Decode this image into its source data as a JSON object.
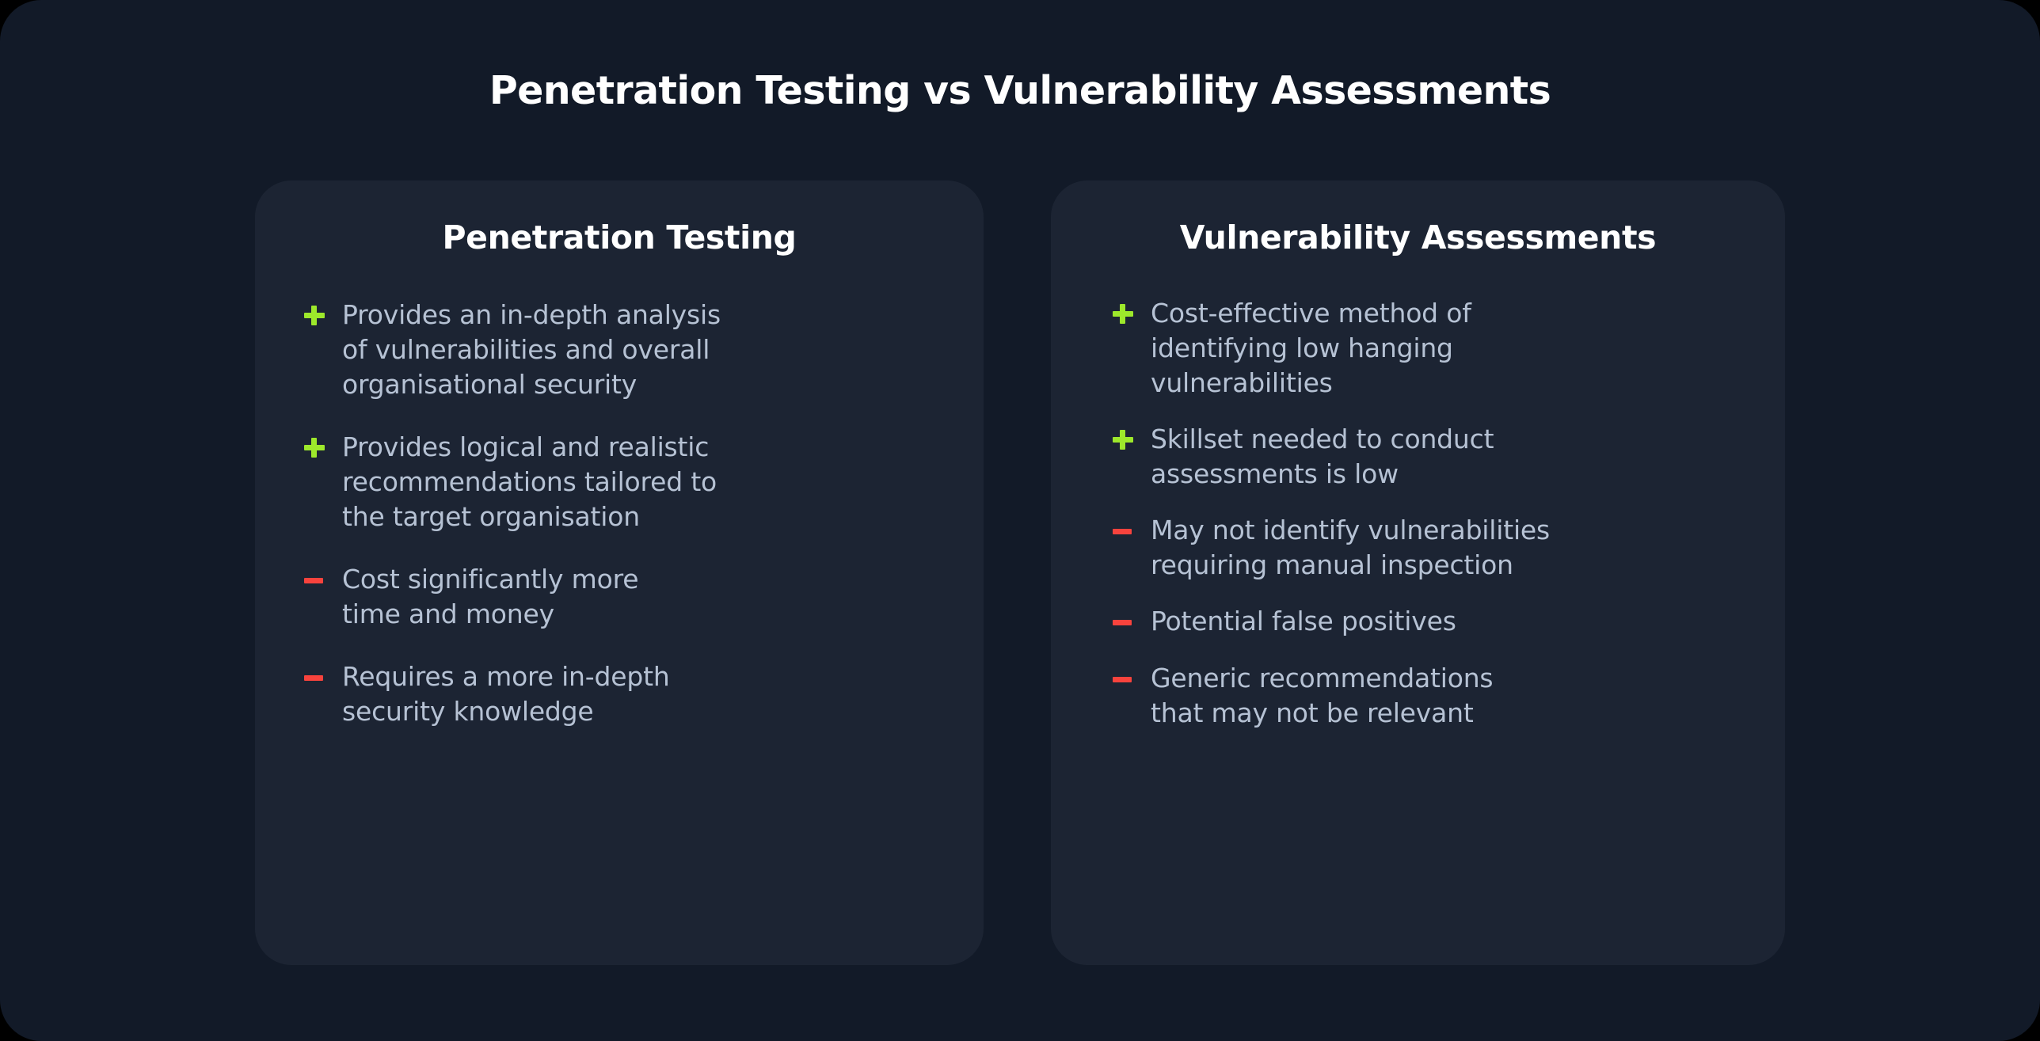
{
  "title": "Penetration Testing vs Vulnerability Assessments",
  "colors": {
    "page_background": "#121A28",
    "card_background": "#1C2433",
    "title_text": "#FFFFFF",
    "body_text": "#B6C2D4",
    "plus_marker": "#9DE82B",
    "minus_marker": "#F8433D"
  },
  "cards": [
    {
      "heading": "Penetration Testing",
      "bullets": [
        {
          "marker": "plus-icon",
          "type": "plus",
          "text": "Provides an in-depth analysis\nof vulnerabilities and overall\norganisational security"
        },
        {
          "marker": "plus-icon",
          "type": "plus",
          "text": "Provides logical and realistic\nrecommendations tailored to\nthe target organisation"
        },
        {
          "marker": "minus-icon",
          "type": "minus",
          "text": "Cost significantly more\ntime and money"
        },
        {
          "marker": "minus-icon",
          "type": "minus",
          "text": "Requires a more in-depth\nsecurity knowledge"
        }
      ]
    },
    {
      "heading": "Vulnerability Assessments",
      "bullets": [
        {
          "marker": "plus-icon",
          "type": "plus",
          "text": "Cost-effective method of\nidentifying low hanging\nvulnerabilities"
        },
        {
          "marker": "plus-icon",
          "type": "plus",
          "text": "Skillset needed to conduct\nassessments is low"
        },
        {
          "marker": "minus-icon",
          "type": "minus",
          "text": "May not identify vulnerabilities\nrequiring manual inspection"
        },
        {
          "marker": "minus-icon",
          "type": "minus",
          "text": "Potential false positives"
        },
        {
          "marker": "minus-icon",
          "type": "minus",
          "text": "Generic recommendations\nthat may not be relevant"
        }
      ]
    }
  ]
}
